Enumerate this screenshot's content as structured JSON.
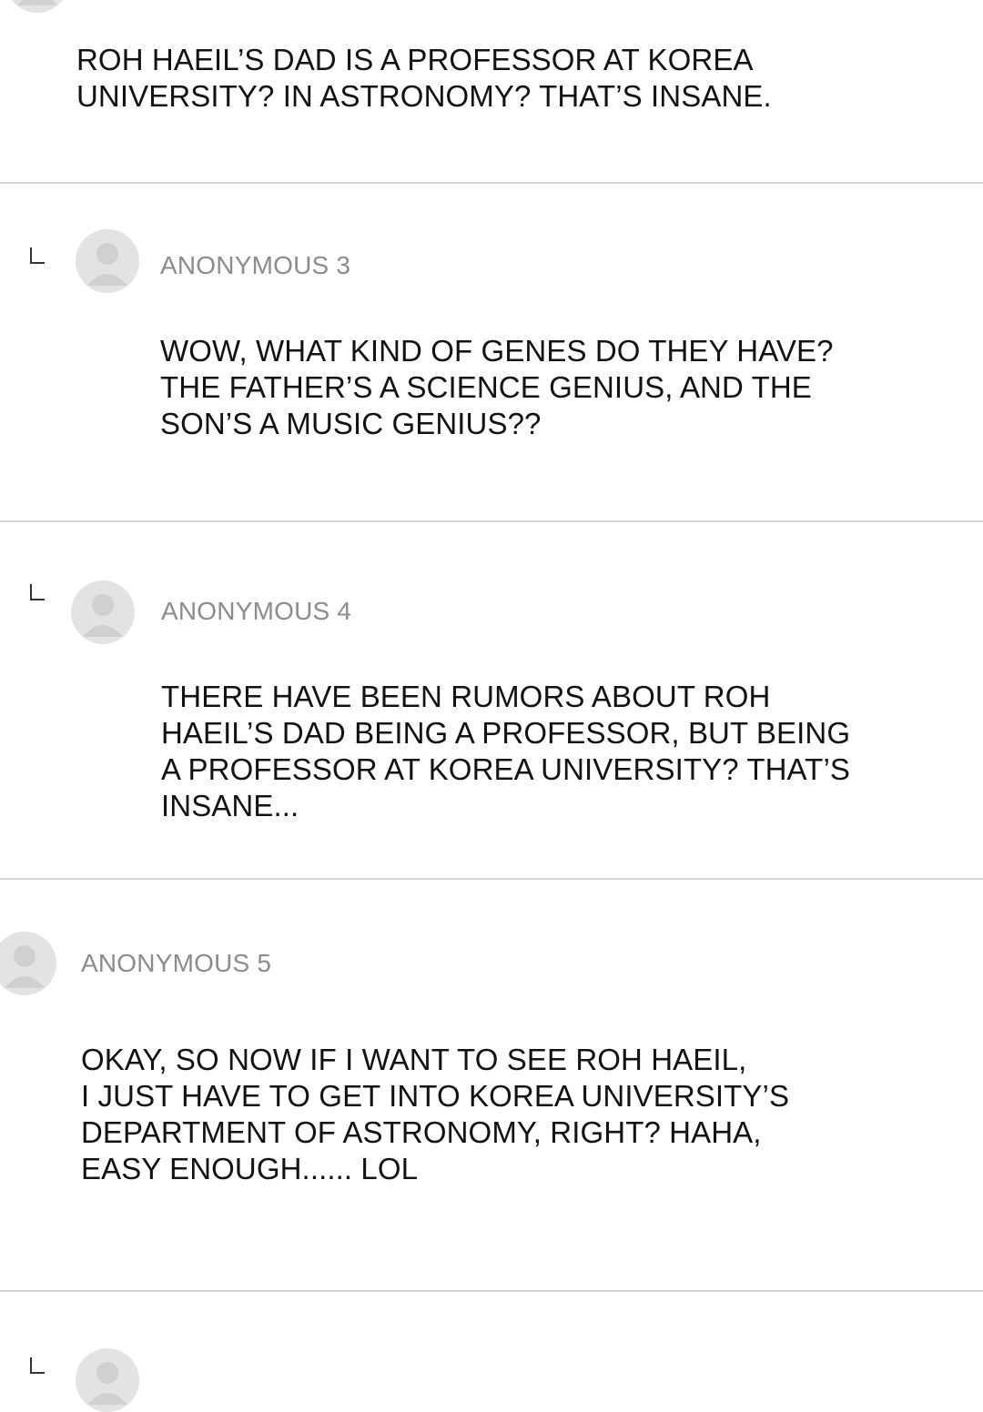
{
  "colors": {
    "background": "#ffffff",
    "author_text": "#8c8c8c",
    "body_text": "#121212",
    "divider": "#d4d4d4",
    "avatar_bg": "#e3e3e3",
    "avatar_figure": "#d0d0d0"
  },
  "comments": [
    {
      "author": "",
      "lines": [
        "ROH HAEIL’S DAD IS A PROFESSOR AT KOREA",
        "UNIVERSITY? IN ASTRONOMY? THAT’S INSANE."
      ]
    },
    {
      "author": "ANONYMOUS 3",
      "reply": true,
      "lines": [
        "WOW, WHAT KIND OF GENES DO THEY HAVE?",
        "THE FATHER’S A SCIENCE GENIUS, AND THE",
        "SON’S A MUSIC GENIUS??"
      ]
    },
    {
      "author": "ANONYMOUS 4",
      "reply": true,
      "lines": [
        "THERE HAVE BEEN RUMORS ABOUT ROH",
        "HAEIL’S DAD BEING A PROFESSOR, BUT BEING",
        "A PROFESSOR AT KOREA UNIVERSITY? THAT’S",
        "INSANE..."
      ]
    },
    {
      "author": "ANONYMOUS 5",
      "reply": false,
      "lines": [
        "OKAY, SO NOW IF I WANT TO SEE ROH HAEIL,",
        "I JUST HAVE TO GET INTO KOREA UNIVERSITY’S",
        "DEPARTMENT OF ASTRONOMY, RIGHT? HAHA,",
        "EASY ENOUGH...... LOL"
      ]
    }
  ]
}
